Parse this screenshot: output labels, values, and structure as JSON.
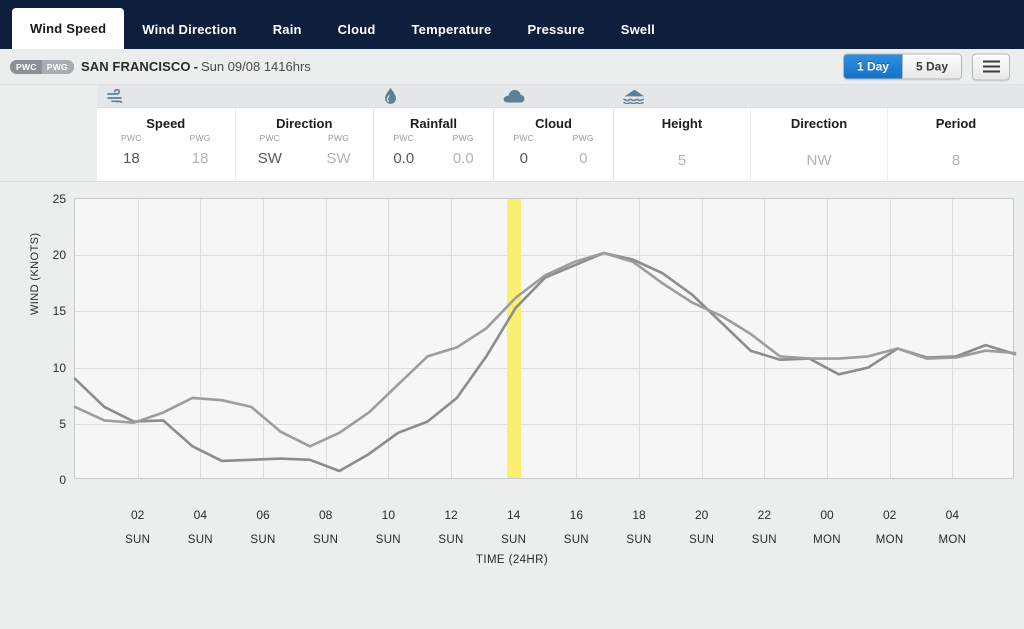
{
  "tabs": [
    {
      "label": "Wind Speed",
      "active": true
    },
    {
      "label": "Wind Direction",
      "active": false
    },
    {
      "label": "Rain",
      "active": false
    },
    {
      "label": "Cloud",
      "active": false
    },
    {
      "label": "Temperature",
      "active": false
    },
    {
      "label": "Pressure",
      "active": false
    },
    {
      "label": "Swell",
      "active": false
    }
  ],
  "location": {
    "badge_primary": "PWC",
    "badge_secondary": "PWG",
    "name": "SAN FRANCISCO",
    "separator": "-",
    "timestamp": "Sun 09/08 1416hrs"
  },
  "range_toggle": {
    "options": [
      {
        "label": "1 Day",
        "active": true
      },
      {
        "label": "5 Day",
        "active": false
      }
    ]
  },
  "menu_button": {
    "label": "menu"
  },
  "summary": {
    "groups": [
      {
        "icon": "wind-icon",
        "columns": [
          {
            "title": "Speed",
            "subs": [
              {
                "label": "PWC",
                "value": "18",
                "muted": false
              },
              {
                "label": "PWG",
                "value": "18",
                "muted": true
              }
            ]
          },
          {
            "title": "Direction",
            "subs": [
              {
                "label": "PWC",
                "value": "SW",
                "muted": false
              },
              {
                "label": "PWG",
                "value": "SW",
                "muted": true
              }
            ]
          }
        ]
      },
      {
        "icon": "raindrop-icon",
        "columns": [
          {
            "title": "Rainfall",
            "subs": [
              {
                "label": "PWC",
                "value": "0.0",
                "muted": false
              },
              {
                "label": "PWG",
                "value": "0.0",
                "muted": true
              }
            ]
          }
        ]
      },
      {
        "icon": "cloud-icon",
        "columns": [
          {
            "title": "Cloud",
            "subs": [
              {
                "label": "PWC",
                "value": "0",
                "muted": false
              },
              {
                "label": "PWG",
                "value": "0",
                "muted": true
              }
            ]
          }
        ]
      },
      {
        "icon": "swell-wave-icon",
        "columns": [
          {
            "title": "Height",
            "subs": [
              {
                "label": "",
                "value": "5",
                "muted": true
              }
            ]
          },
          {
            "title": "Direction",
            "subs": [
              {
                "label": "",
                "value": "NW",
                "muted": true
              }
            ]
          },
          {
            "title": "Period",
            "subs": [
              {
                "label": "",
                "value": "8",
                "muted": true
              }
            ]
          }
        ]
      }
    ]
  },
  "chart_data": {
    "type": "line",
    "title": "",
    "xlabel": "TIME (24HR)",
    "ylabel": "WIND (KNOTS)",
    "ylim": [
      0,
      25
    ],
    "yticks": [
      0,
      5,
      10,
      15,
      20,
      25
    ],
    "grid": true,
    "legend": "none",
    "x": [
      0,
      1,
      2,
      3,
      4,
      5,
      6,
      7,
      8,
      9,
      10,
      11,
      12,
      13,
      14,
      15,
      16,
      17,
      18,
      19,
      20,
      21,
      22,
      23,
      24,
      25,
      26,
      27,
      28,
      29
    ],
    "xtick_labels": [
      {
        "hour": "02",
        "day": "SUN"
      },
      {
        "hour": "04",
        "day": "SUN"
      },
      {
        "hour": "06",
        "day": "SUN"
      },
      {
        "hour": "08",
        "day": "SUN"
      },
      {
        "hour": "10",
        "day": "SUN"
      },
      {
        "hour": "12",
        "day": "SUN"
      },
      {
        "hour": "14",
        "day": "SUN"
      },
      {
        "hour": "16",
        "day": "SUN"
      },
      {
        "hour": "18",
        "day": "SUN"
      },
      {
        "hour": "20",
        "day": "SUN"
      },
      {
        "hour": "22",
        "day": "SUN"
      },
      {
        "hour": "00",
        "day": "MON"
      },
      {
        "hour": "02",
        "day": "MON"
      },
      {
        "hour": "04",
        "day": "MON"
      }
    ],
    "now_marker": {
      "label": "14 SUN",
      "index": 13,
      "color": "#fbef72"
    },
    "series": [
      {
        "name": "PWG",
        "color": "#8a8c8e",
        "values": [
          9.0,
          6.5,
          5.2,
          5.3,
          3.0,
          1.7,
          1.8,
          1.9,
          1.8,
          0.8,
          2.3,
          4.2,
          5.2,
          7.3,
          11.0,
          15.3,
          18.0,
          19.1,
          20.2,
          19.6,
          18.4,
          16.5,
          14.0,
          11.5,
          10.7,
          10.8,
          9.4,
          10.0,
          11.7,
          10.9,
          11.0,
          12.0,
          11.2
        ]
      },
      {
        "name": "PWC",
        "color": "#9b9d9f",
        "values": [
          6.5,
          5.3,
          5.1,
          6.0,
          7.3,
          7.1,
          6.5,
          4.3,
          3.0,
          4.2,
          6.0,
          8.5,
          11.0,
          11.8,
          13.5,
          16.2,
          18.2,
          19.4,
          20.2,
          19.4,
          17.5,
          15.8,
          14.6,
          13.0,
          11.0,
          10.8,
          10.8,
          11.0,
          11.7,
          10.8,
          10.9,
          11.5,
          11.3
        ]
      }
    ]
  }
}
